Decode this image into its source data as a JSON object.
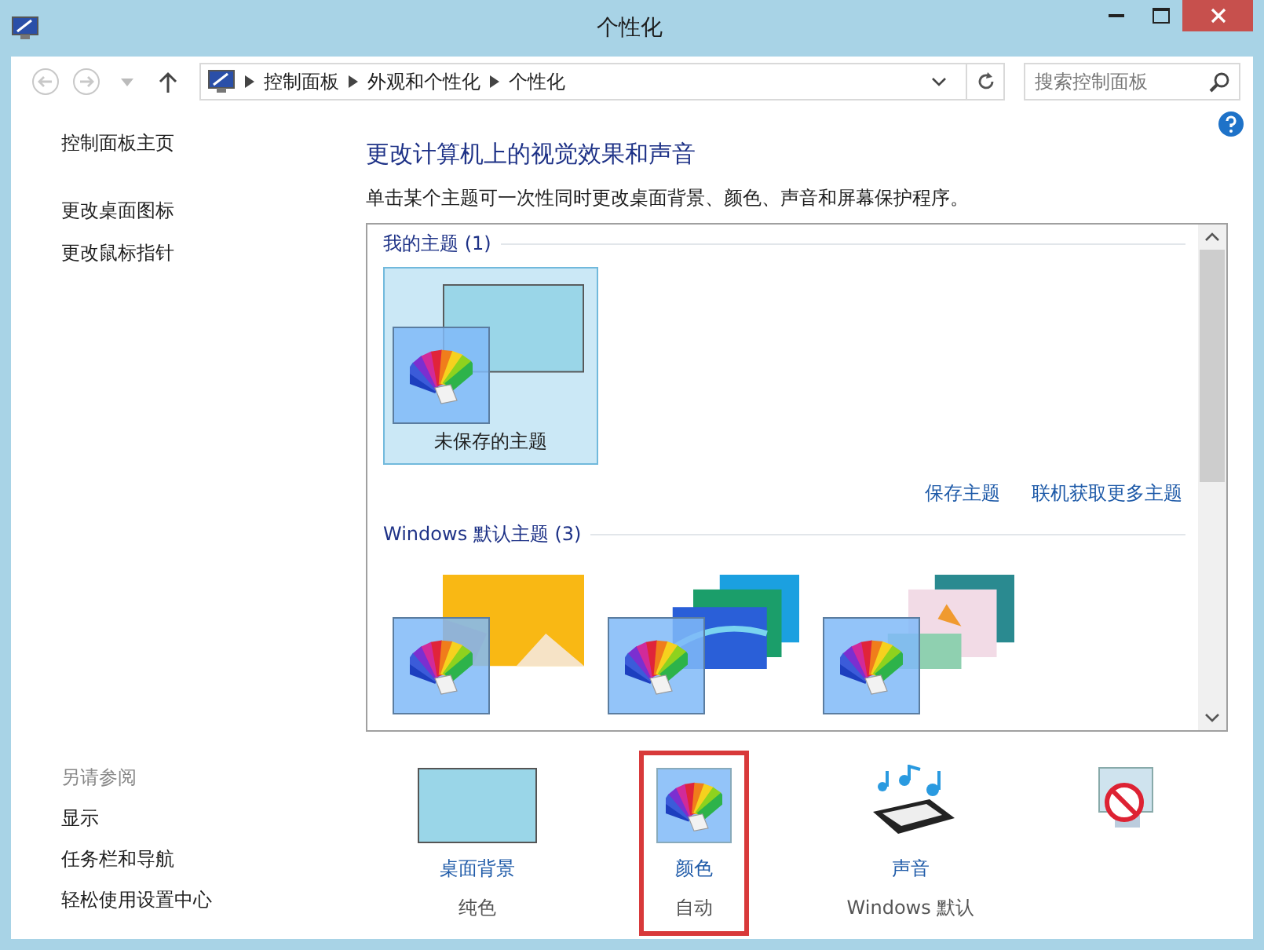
{
  "window": {
    "title": "个性化"
  },
  "address_bar": {
    "path": [
      "控制面板",
      "外观和个性化",
      "个性化"
    ]
  },
  "search": {
    "placeholder": "搜索控制面板"
  },
  "sidebar": {
    "items": [
      "控制面板主页",
      "更改桌面图标",
      "更改鼠标指针"
    ],
    "see_also": {
      "heading": "另请参阅",
      "items": [
        "显示",
        "任务栏和导航",
        "轻松使用设置中心"
      ]
    }
  },
  "main": {
    "title": "更改计算机上的视觉效果和声音",
    "description": "单击某个主题可一次性同时更改桌面背景、颜色、声音和屏幕保护程序。",
    "theme_groups": [
      {
        "heading": "我的主题 (1)",
        "themes": [
          {
            "label": "未保存的主题",
            "kind": "plain",
            "selected": true
          }
        ],
        "links": [
          "保存主题",
          "联机获取更多主题"
        ]
      },
      {
        "heading": "Windows 默认主题 (3)",
        "themes": [
          {
            "kind": "windows",
            "selected": false
          },
          {
            "kind": "lines",
            "selected": false
          },
          {
            "kind": "flowers",
            "selected": false
          }
        ]
      }
    ],
    "settings": [
      {
        "kind": "background",
        "label": "桌面背景",
        "value": "纯色",
        "highlighted": false
      },
      {
        "kind": "color",
        "label": "颜色",
        "value": "自动",
        "highlighted": true
      },
      {
        "kind": "sound",
        "label": "声音",
        "value": "Windows 默认",
        "highlighted": false
      },
      {
        "kind": "screensaver",
        "highlighted": false
      }
    ]
  }
}
